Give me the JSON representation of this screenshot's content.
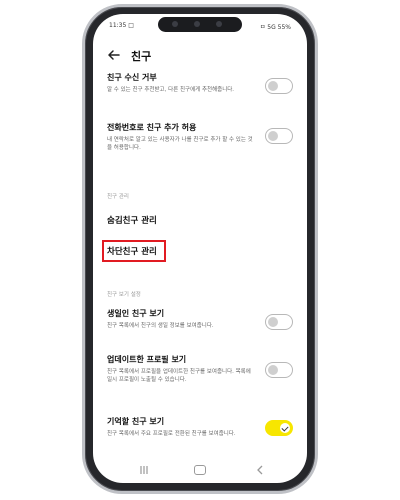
{
  "status_bar": {
    "time": "11:35 □",
    "right": "ㅁ 5G 55%"
  },
  "header": {
    "title": "친구",
    "back_icon": "back-arrow-icon"
  },
  "sections": {
    "friend_manage_label": "친구 관리",
    "friend_view_label": "친구 보기 설정"
  },
  "items": {
    "send_receive": {
      "title": "친구 수신 거부",
      "desc": "알 수 있는 친구 추천받고, 다른 친구에게 추천해줍니다.",
      "toggle": false
    },
    "add_by_phone": {
      "title": "전화번호로 친구 추가 허용",
      "desc": "내 연락처로 알고 있는 사용자가 나를 친구로 추가 할 수 있는 것을 허용합니다.",
      "toggle": false
    },
    "hidden_manage": "숨김친구 관리",
    "blocked_manage": "차단친구 관리",
    "birthday": {
      "title": "생일인 친구 보기",
      "desc": "친구 목록에서 친구의 생일 정보를 보여줍니다.",
      "toggle": false
    },
    "updated_profile": {
      "title": "업데이트한 프로필 보기",
      "desc": "친구 목록에서 프로필을 업데이트한 친구를 보여줍니다. 목록에 일시 프로필이 노출될 수 있습니다.",
      "toggle": false
    },
    "memorable": {
      "title": "기억할 친구 보기",
      "desc": "친구 목록에서 주요 프로필로 전환된 친구를 보여줍니다.",
      "toggle": true
    }
  },
  "colors": {
    "accent_toggle": "#f7e600",
    "highlight": "#e11b22"
  }
}
